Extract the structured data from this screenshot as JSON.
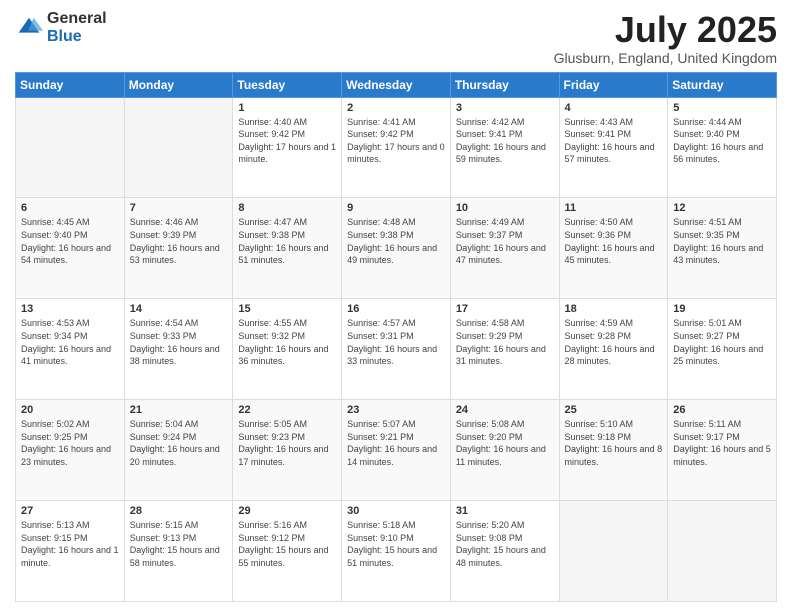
{
  "logo": {
    "general": "General",
    "blue": "Blue"
  },
  "title": {
    "month": "July 2025",
    "location": "Glusburn, England, United Kingdom"
  },
  "days_of_week": [
    "Sunday",
    "Monday",
    "Tuesday",
    "Wednesday",
    "Thursday",
    "Friday",
    "Saturday"
  ],
  "weeks": [
    [
      {
        "day": "",
        "sunrise": "",
        "sunset": "",
        "daylight": ""
      },
      {
        "day": "",
        "sunrise": "",
        "sunset": "",
        "daylight": ""
      },
      {
        "day": "1",
        "sunrise": "Sunrise: 4:40 AM",
        "sunset": "Sunset: 9:42 PM",
        "daylight": "Daylight: 17 hours and 1 minute."
      },
      {
        "day": "2",
        "sunrise": "Sunrise: 4:41 AM",
        "sunset": "Sunset: 9:42 PM",
        "daylight": "Daylight: 17 hours and 0 minutes."
      },
      {
        "day": "3",
        "sunrise": "Sunrise: 4:42 AM",
        "sunset": "Sunset: 9:41 PM",
        "daylight": "Daylight: 16 hours and 59 minutes."
      },
      {
        "day": "4",
        "sunrise": "Sunrise: 4:43 AM",
        "sunset": "Sunset: 9:41 PM",
        "daylight": "Daylight: 16 hours and 57 minutes."
      },
      {
        "day": "5",
        "sunrise": "Sunrise: 4:44 AM",
        "sunset": "Sunset: 9:40 PM",
        "daylight": "Daylight: 16 hours and 56 minutes."
      }
    ],
    [
      {
        "day": "6",
        "sunrise": "Sunrise: 4:45 AM",
        "sunset": "Sunset: 9:40 PM",
        "daylight": "Daylight: 16 hours and 54 minutes."
      },
      {
        "day": "7",
        "sunrise": "Sunrise: 4:46 AM",
        "sunset": "Sunset: 9:39 PM",
        "daylight": "Daylight: 16 hours and 53 minutes."
      },
      {
        "day": "8",
        "sunrise": "Sunrise: 4:47 AM",
        "sunset": "Sunset: 9:38 PM",
        "daylight": "Daylight: 16 hours and 51 minutes."
      },
      {
        "day": "9",
        "sunrise": "Sunrise: 4:48 AM",
        "sunset": "Sunset: 9:38 PM",
        "daylight": "Daylight: 16 hours and 49 minutes."
      },
      {
        "day": "10",
        "sunrise": "Sunrise: 4:49 AM",
        "sunset": "Sunset: 9:37 PM",
        "daylight": "Daylight: 16 hours and 47 minutes."
      },
      {
        "day": "11",
        "sunrise": "Sunrise: 4:50 AM",
        "sunset": "Sunset: 9:36 PM",
        "daylight": "Daylight: 16 hours and 45 minutes."
      },
      {
        "day": "12",
        "sunrise": "Sunrise: 4:51 AM",
        "sunset": "Sunset: 9:35 PM",
        "daylight": "Daylight: 16 hours and 43 minutes."
      }
    ],
    [
      {
        "day": "13",
        "sunrise": "Sunrise: 4:53 AM",
        "sunset": "Sunset: 9:34 PM",
        "daylight": "Daylight: 16 hours and 41 minutes."
      },
      {
        "day": "14",
        "sunrise": "Sunrise: 4:54 AM",
        "sunset": "Sunset: 9:33 PM",
        "daylight": "Daylight: 16 hours and 38 minutes."
      },
      {
        "day": "15",
        "sunrise": "Sunrise: 4:55 AM",
        "sunset": "Sunset: 9:32 PM",
        "daylight": "Daylight: 16 hours and 36 minutes."
      },
      {
        "day": "16",
        "sunrise": "Sunrise: 4:57 AM",
        "sunset": "Sunset: 9:31 PM",
        "daylight": "Daylight: 16 hours and 33 minutes."
      },
      {
        "day": "17",
        "sunrise": "Sunrise: 4:58 AM",
        "sunset": "Sunset: 9:29 PM",
        "daylight": "Daylight: 16 hours and 31 minutes."
      },
      {
        "day": "18",
        "sunrise": "Sunrise: 4:59 AM",
        "sunset": "Sunset: 9:28 PM",
        "daylight": "Daylight: 16 hours and 28 minutes."
      },
      {
        "day": "19",
        "sunrise": "Sunrise: 5:01 AM",
        "sunset": "Sunset: 9:27 PM",
        "daylight": "Daylight: 16 hours and 25 minutes."
      }
    ],
    [
      {
        "day": "20",
        "sunrise": "Sunrise: 5:02 AM",
        "sunset": "Sunset: 9:25 PM",
        "daylight": "Daylight: 16 hours and 23 minutes."
      },
      {
        "day": "21",
        "sunrise": "Sunrise: 5:04 AM",
        "sunset": "Sunset: 9:24 PM",
        "daylight": "Daylight: 16 hours and 20 minutes."
      },
      {
        "day": "22",
        "sunrise": "Sunrise: 5:05 AM",
        "sunset": "Sunset: 9:23 PM",
        "daylight": "Daylight: 16 hours and 17 minutes."
      },
      {
        "day": "23",
        "sunrise": "Sunrise: 5:07 AM",
        "sunset": "Sunset: 9:21 PM",
        "daylight": "Daylight: 16 hours and 14 minutes."
      },
      {
        "day": "24",
        "sunrise": "Sunrise: 5:08 AM",
        "sunset": "Sunset: 9:20 PM",
        "daylight": "Daylight: 16 hours and 11 minutes."
      },
      {
        "day": "25",
        "sunrise": "Sunrise: 5:10 AM",
        "sunset": "Sunset: 9:18 PM",
        "daylight": "Daylight: 16 hours and 8 minutes."
      },
      {
        "day": "26",
        "sunrise": "Sunrise: 5:11 AM",
        "sunset": "Sunset: 9:17 PM",
        "daylight": "Daylight: 16 hours and 5 minutes."
      }
    ],
    [
      {
        "day": "27",
        "sunrise": "Sunrise: 5:13 AM",
        "sunset": "Sunset: 9:15 PM",
        "daylight": "Daylight: 16 hours and 1 minute."
      },
      {
        "day": "28",
        "sunrise": "Sunrise: 5:15 AM",
        "sunset": "Sunset: 9:13 PM",
        "daylight": "Daylight: 15 hours and 58 minutes."
      },
      {
        "day": "29",
        "sunrise": "Sunrise: 5:16 AM",
        "sunset": "Sunset: 9:12 PM",
        "daylight": "Daylight: 15 hours and 55 minutes."
      },
      {
        "day": "30",
        "sunrise": "Sunrise: 5:18 AM",
        "sunset": "Sunset: 9:10 PM",
        "daylight": "Daylight: 15 hours and 51 minutes."
      },
      {
        "day": "31",
        "sunrise": "Sunrise: 5:20 AM",
        "sunset": "Sunset: 9:08 PM",
        "daylight": "Daylight: 15 hours and 48 minutes."
      },
      {
        "day": "",
        "sunrise": "",
        "sunset": "",
        "daylight": ""
      },
      {
        "day": "",
        "sunrise": "",
        "sunset": "",
        "daylight": ""
      }
    ]
  ]
}
